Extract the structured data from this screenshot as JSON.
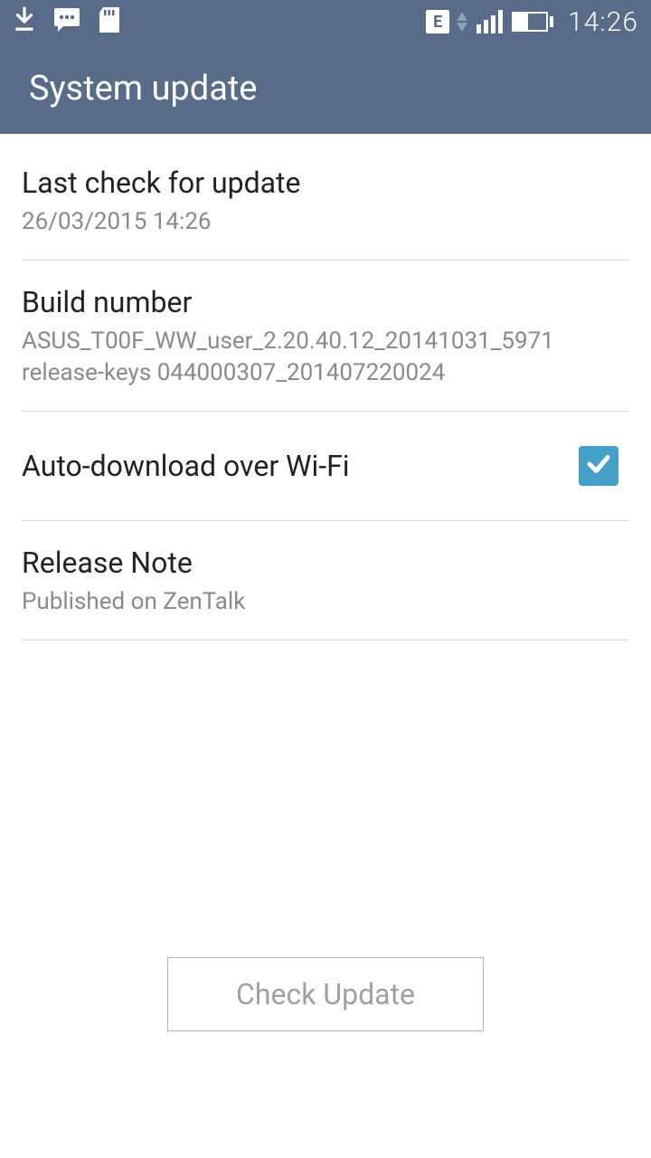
{
  "status": {
    "time": "14:26",
    "edge_label": "E"
  },
  "header": {
    "title": "System update"
  },
  "items": {
    "last_check": {
      "title": "Last check for update",
      "value": "26/03/2015 14:26"
    },
    "build": {
      "title": "Build number",
      "value": "ASUS_T00F_WW_user_2.20.40.12_20141031_5971 release-keys 044000307_201407220024"
    },
    "auto_dl": {
      "title": "Auto-download over Wi-Fi",
      "checked": true
    },
    "release_note": {
      "title": "Release Note",
      "sub": "Published on ZenTalk"
    }
  },
  "footer": {
    "check_label": "Check Update"
  }
}
